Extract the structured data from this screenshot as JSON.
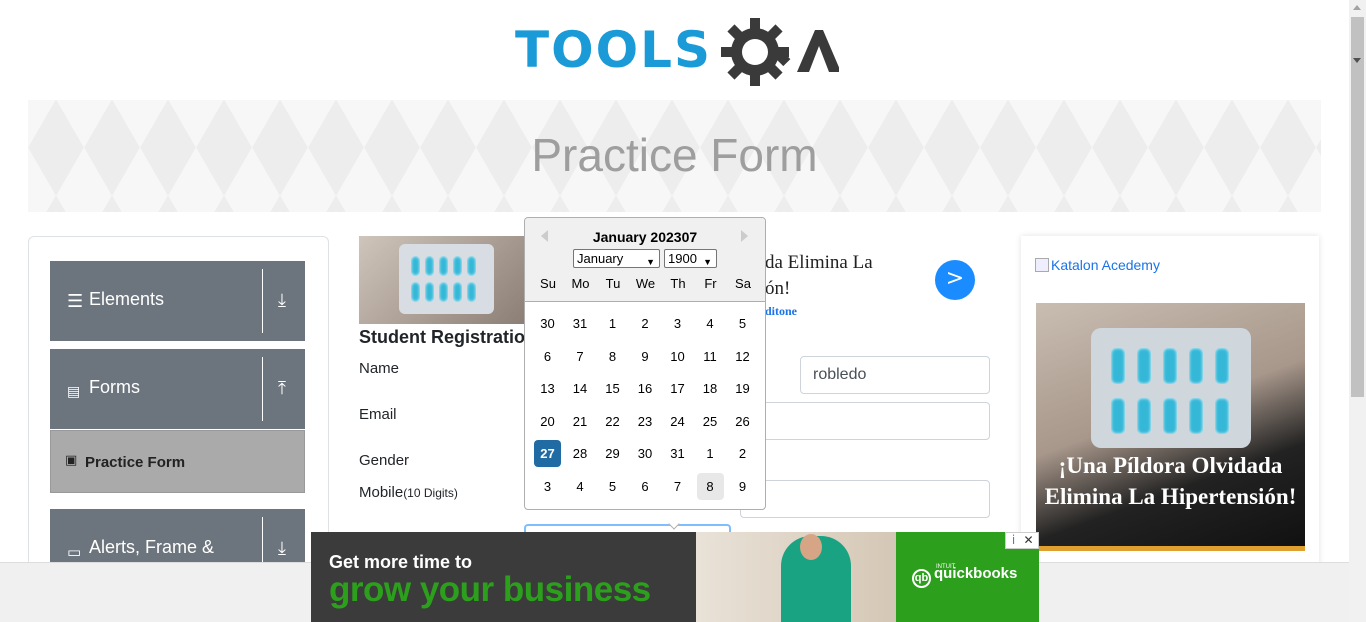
{
  "logo": {
    "text_part": "TOOLS",
    "alt": "TOOLSQA"
  },
  "banner": {
    "title": "Practice Form"
  },
  "sidebar": {
    "groups": [
      {
        "label": "Elements",
        "icon": "hamburger-icon",
        "arrow": "download-arrow-icon"
      },
      {
        "label": "Forms",
        "icon": "document-icon",
        "arrow": "upload-arrow-icon"
      },
      {
        "label": "Alerts, Frame &",
        "icon": "window-icon",
        "arrow": "download-arrow-icon"
      }
    ],
    "active_item": {
      "label": "Practice Form",
      "icon": "form-icon"
    }
  },
  "form": {
    "title": "Student Registratio",
    "labels": {
      "name": "Name",
      "email": "Email",
      "gender": "Gender",
      "mobile": "Mobile",
      "mobile_hint": "(10 Digits)"
    },
    "last_name_value": "robledo"
  },
  "inline_ad": {
    "text_line1": "da Elimina La",
    "text_line2": "ón!",
    "source": "ditone",
    "go_label": ">"
  },
  "calendar": {
    "header": "January 202307",
    "month_select": "January",
    "year_select": "1900",
    "day_names": [
      "Su",
      "Mo",
      "Tu",
      "We",
      "Th",
      "Fr",
      "Sa"
    ],
    "weeks": [
      [
        "30",
        "31",
        "1",
        "2",
        "3",
        "4",
        "5"
      ],
      [
        "6",
        "7",
        "8",
        "9",
        "10",
        "11",
        "12"
      ],
      [
        "13",
        "14",
        "15",
        "16",
        "17",
        "18",
        "19"
      ],
      [
        "20",
        "21",
        "22",
        "23",
        "24",
        "25",
        "26"
      ],
      [
        "27",
        "28",
        "29",
        "30",
        "31",
        "1",
        "2"
      ],
      [
        "3",
        "4",
        "5",
        "6",
        "7",
        "8",
        "9"
      ]
    ],
    "selected_day": "27",
    "keyboard_day": "8"
  },
  "right_ad": {
    "link_text": "Katalon Acedemy",
    "headline": "¡Una Píldora Olvidada Elimina La Hipertensión!"
  },
  "bottom_ad": {
    "line1": "Get more time to",
    "line2": "grow your business",
    "brand_prefix": "INTUIT",
    "brand": "quickbooks",
    "brand_mark": "qb",
    "adchoices_info": "i",
    "adchoices_close": "✕"
  },
  "colors": {
    "brand_blue": "#1a9ad6",
    "sidebar_gray": "#6c757d",
    "selected_day": "#216ba5",
    "quickbooks_green": "#2ca01c"
  }
}
